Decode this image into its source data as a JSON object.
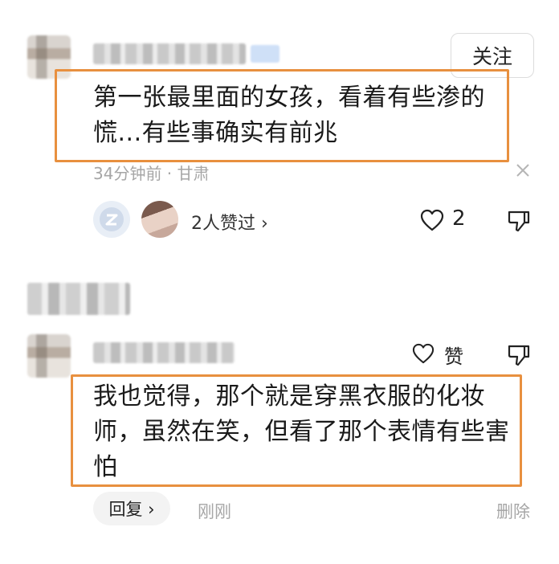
{
  "comment1": {
    "follow_label": "关注",
    "text_line1": "第一张最里面的女孩，看着有些渗的",
    "text_line2": "慌...有些事确实有前兆",
    "meta": "34分钟前 · 甘肃",
    "likers_summary": "2人赞过 ›",
    "like_count": "2"
  },
  "reply": {
    "like_label": "赞",
    "text_line1": "我也觉得，那个就是穿黑衣服的化妆",
    "text_line2": "师，虽然在笑，但看了那个表情有些害",
    "text_line3": "怕",
    "reply_button": "回复 ›",
    "time": "刚刚",
    "delete_label": "删除"
  },
  "colors": {
    "highlight_border": "#e8903f",
    "meta_gray": "#a6a6a6"
  }
}
